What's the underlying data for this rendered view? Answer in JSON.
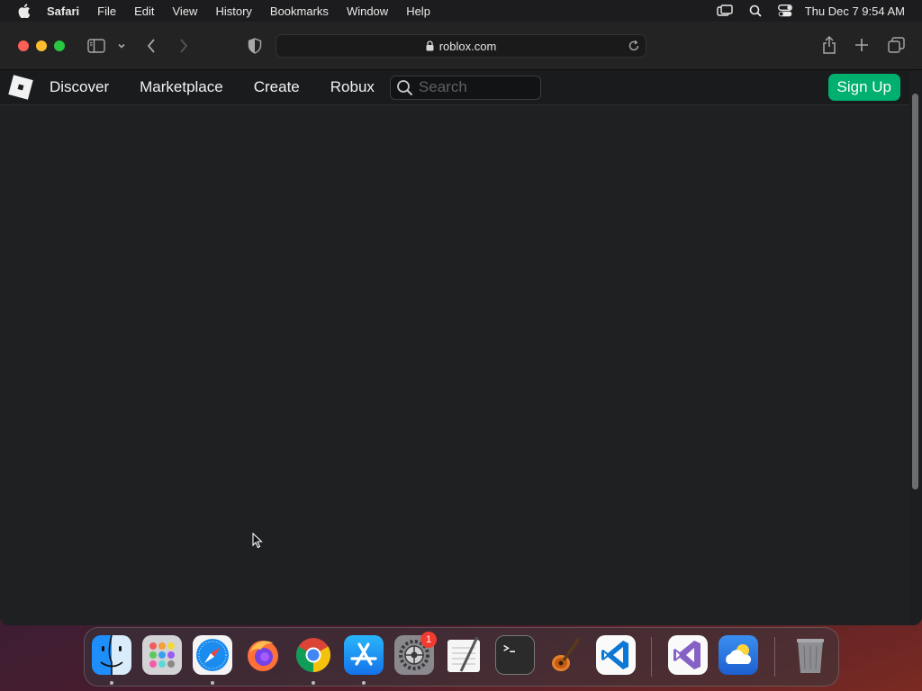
{
  "menubar": {
    "app_name": "Safari",
    "menus": [
      "File",
      "Edit",
      "View",
      "History",
      "Bookmarks",
      "Window",
      "Help"
    ],
    "clock": "Thu Dec 7  9:54 AM",
    "status_icons": [
      "screen-mirroring-icon",
      "spotlight-search-icon",
      "control-center-icon"
    ]
  },
  "browser": {
    "url": "roblox.com",
    "toolbar_icons": [
      "sidebar-icon",
      "chevron-down-icon",
      "back-icon",
      "forward-icon",
      "privacy-shield-icon",
      "share-icon",
      "new-tab-icon",
      "tab-overview-icon"
    ]
  },
  "roblox": {
    "nav": [
      "Discover",
      "Marketplace",
      "Create",
      "Robux"
    ],
    "search_placeholder": "Search",
    "signup_label": "Sign Up",
    "colors": {
      "signup": "#00b06f",
      "nav_bg": "#191b1d",
      "page_bg": "#1e2021"
    }
  },
  "dock": {
    "apps": [
      "Finder",
      "Launchpad",
      "Safari",
      "Firefox",
      "Google Chrome",
      "App Store",
      "System Settings",
      "TextEdit",
      "Terminal",
      "GarageBand",
      "Visual Studio Code",
      "Visual Studio",
      "Weather",
      "Trash"
    ],
    "system_settings_badge": "1"
  }
}
